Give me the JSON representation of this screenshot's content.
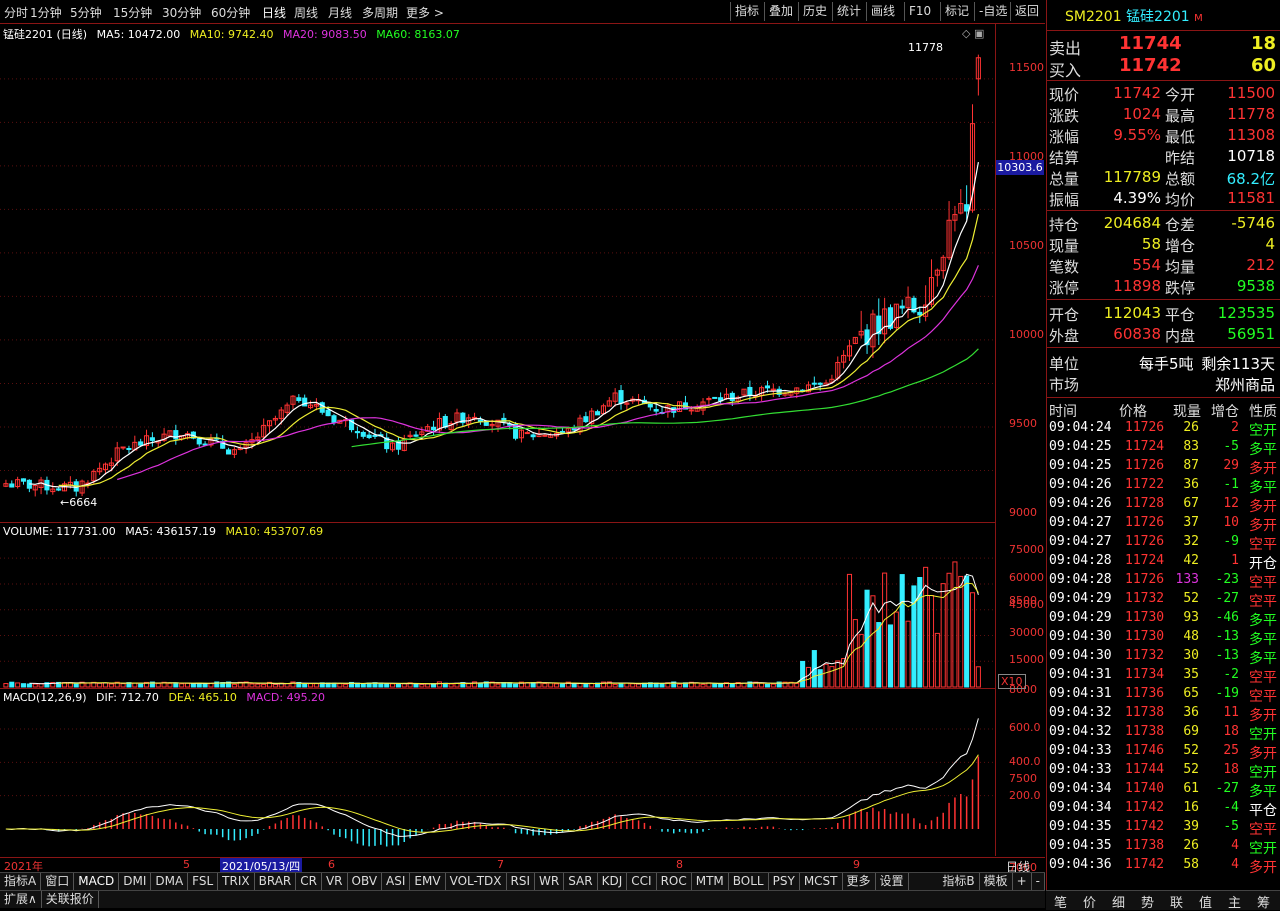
{
  "toolbar": {
    "left": [
      "分时",
      "1分钟",
      "5分钟",
      "15分钟",
      "30分钟",
      "60分钟",
      "日线",
      "周线",
      "月线",
      "多周期",
      "更多 >"
    ],
    "right": [
      "指标",
      "叠加",
      "历史",
      "统计",
      "画线",
      "F10",
      "标记",
      "-自选",
      "返回"
    ]
  },
  "main": {
    "title": "锰硅2201 (日线)",
    "ma5": "MA5: 10472.00",
    "ma10": "MA10: 9742.40",
    "ma20": "MA20: 9083.50",
    "ma60": "MA60: 8163.07",
    "yticks": [
      "11500",
      "11000",
      "10500",
      "10000",
      "9500",
      "9000",
      "8500",
      "8000",
      "7500",
      "7000"
    ],
    "price_tag": "10303.6",
    "high_label": "11778",
    "low_label": "6664"
  },
  "volume": {
    "title": "VOLUME: 117731.00",
    "ma5": "MA5: 436157.19",
    "ma10": "MA10: 453707.69",
    "yticks": [
      "75000",
      "60000",
      "45000",
      "30000",
      "15000"
    ],
    "unit": "X10"
  },
  "macd": {
    "title": "MACD(12,26,9)",
    "dif": "DIF: 712.70",
    "dea": "DEA: 465.10",
    "macd": "MACD: 495.20",
    "yticks": [
      "600.0",
      "400.0",
      "200.0"
    ]
  },
  "axis": {
    "year": "2021年",
    "cursor": "2021/05/13/四",
    "months": [
      "5",
      "6",
      "7",
      "8",
      "9"
    ],
    "period": "日线"
  },
  "tabs_indicators": [
    "指标A",
    "窗口",
    "MACD",
    "DMI",
    "DMA",
    "FSL",
    "TRIX",
    "BRAR",
    "CR",
    "VR",
    "OBV",
    "ASI",
    "EMV",
    "VOL-TDX",
    "RSI",
    "WR",
    "SAR",
    "KDJ",
    "CCI",
    "ROC",
    "MTM",
    "BOLL",
    "PSY",
    "MCST",
    "更多",
    "设置"
  ],
  "tabs_right": [
    "指标B",
    "模板",
    "+",
    "-"
  ],
  "tabs_bottom": [
    "扩展∧",
    "关联报价"
  ],
  "quote": {
    "code": "SM2201",
    "name": "锰硅2201",
    "mark": "M",
    "sell_label": "卖出",
    "sell_price": "11744",
    "sell_qty": "18",
    "buy_label": "买入",
    "buy_price": "11742",
    "buy_qty": "60",
    "rows1": [
      {
        "l1": "现价",
        "v1": "11742",
        "l2": "今开",
        "v2": "11500"
      },
      {
        "l1": "涨跌",
        "v1": "1024",
        "l2": "最高",
        "v2": "11778"
      },
      {
        "l1": "涨幅",
        "v1": "9.55%",
        "l2": "最低",
        "v2": "11308"
      },
      {
        "l1": "结算",
        "v1": "",
        "l2": "昨结",
        "v2": "10718"
      },
      {
        "l1": "总量",
        "v1": "117789",
        "l2": "总额",
        "v2": "68.2亿"
      },
      {
        "l1": "振幅",
        "v1": "4.39%",
        "l2": "均价",
        "v2": "11581"
      }
    ],
    "rows2": [
      {
        "l1": "持仓",
        "v1": "204684",
        "l2": "仓差",
        "v2": "-5746"
      },
      {
        "l1": "现量",
        "v1": "58",
        "l2": "增仓",
        "v2": "4"
      },
      {
        "l1": "笔数",
        "v1": "554",
        "l2": "均量",
        "v2": "212"
      },
      {
        "l1": "涨停",
        "v1": "11898",
        "l2": "跌停",
        "v2": "9538"
      }
    ],
    "rows3": [
      {
        "l1": "开仓",
        "v1": "112043",
        "l2": "平仓",
        "v2": "123535"
      },
      {
        "l1": "外盘",
        "v1": "60838",
        "l2": "内盘",
        "v2": "56951"
      }
    ],
    "unit_label": "单位",
    "unit_value": "每手5吨",
    "remain": "剩余113天",
    "market_label": "市场",
    "market_value": "郑州商品"
  },
  "ticks_header": [
    "时间",
    "价格",
    "现量",
    "增仓",
    "性质"
  ],
  "ticks": [
    [
      "09:04:24",
      "11726",
      "26",
      "2",
      "空开"
    ],
    [
      "09:04:25",
      "11724",
      "83",
      "-5",
      "多平"
    ],
    [
      "09:04:25",
      "11726",
      "87",
      "29",
      "多开"
    ],
    [
      "09:04:26",
      "11722",
      "36",
      "-1",
      "多平"
    ],
    [
      "09:04:26",
      "11728",
      "67",
      "12",
      "多开"
    ],
    [
      "09:04:27",
      "11726",
      "37",
      "10",
      "多开"
    ],
    [
      "09:04:27",
      "11726",
      "32",
      "-9",
      "空平"
    ],
    [
      "09:04:28",
      "11724",
      "42",
      "1",
      "开仓"
    ],
    [
      "09:04:28",
      "11726",
      "133",
      "-23",
      "空平"
    ],
    [
      "09:04:29",
      "11732",
      "52",
      "-27",
      "空平"
    ],
    [
      "09:04:29",
      "11730",
      "93",
      "-46",
      "多平"
    ],
    [
      "09:04:30",
      "11730",
      "48",
      "-13",
      "多平"
    ],
    [
      "09:04:30",
      "11732",
      "30",
      "-13",
      "多平"
    ],
    [
      "09:04:31",
      "11734",
      "35",
      "-2",
      "空平"
    ],
    [
      "09:04:31",
      "11736",
      "65",
      "-19",
      "空平"
    ],
    [
      "09:04:32",
      "11738",
      "36",
      "11",
      "多开"
    ],
    [
      "09:04:32",
      "11738",
      "69",
      "18",
      "空开"
    ],
    [
      "09:04:33",
      "11746",
      "52",
      "25",
      "多开"
    ],
    [
      "09:04:33",
      "11744",
      "52",
      "18",
      "空开"
    ],
    [
      "09:04:34",
      "11740",
      "61",
      "-27",
      "多平"
    ],
    [
      "09:04:34",
      "11742",
      "16",
      "-4",
      "平仓"
    ],
    [
      "09:04:35",
      "11742",
      "39",
      "-5",
      "空平"
    ],
    [
      "09:04:35",
      "11738",
      "26",
      "4",
      "空开"
    ],
    [
      "09:04:36",
      "11742",
      "58",
      "4",
      "多开"
    ]
  ],
  "bottom_tabs": [
    "笔",
    "价",
    "细",
    "势",
    "联",
    "值",
    "主",
    "筹"
  ],
  "colors": {
    "up": "#ff3333",
    "down": "#33eeff",
    "ma5": "#ffffff",
    "ma10": "#eeee33",
    "ma20": "#dd33dd",
    "ma60": "#33dd33"
  },
  "chart_data": {
    "type": "candlestick",
    "title": "锰硅2201 (日线)",
    "ylim": [
      6500,
      11900
    ],
    "anchors": [
      [
        0,
        6850
      ],
      [
        12,
        6800
      ],
      [
        20,
        7250
      ],
      [
        30,
        7450
      ],
      [
        40,
        7200
      ],
      [
        50,
        7850
      ],
      [
        56,
        7600
      ],
      [
        60,
        7500
      ],
      [
        66,
        7250
      ],
      [
        72,
        7500
      ],
      [
        80,
        7650
      ],
      [
        88,
        7400
      ],
      [
        96,
        7450
      ],
      [
        104,
        7850
      ],
      [
        112,
        7700
      ],
      [
        120,
        7800
      ],
      [
        128,
        7900
      ],
      [
        135,
        7950
      ],
      [
        140,
        8000
      ],
      [
        145,
        8500
      ],
      [
        150,
        8750
      ],
      [
        156,
        8900
      ],
      [
        160,
        9600
      ],
      [
        162,
        10050
      ],
      [
        164,
        9900
      ],
      [
        166,
        11742
      ]
    ],
    "count": 167
  }
}
